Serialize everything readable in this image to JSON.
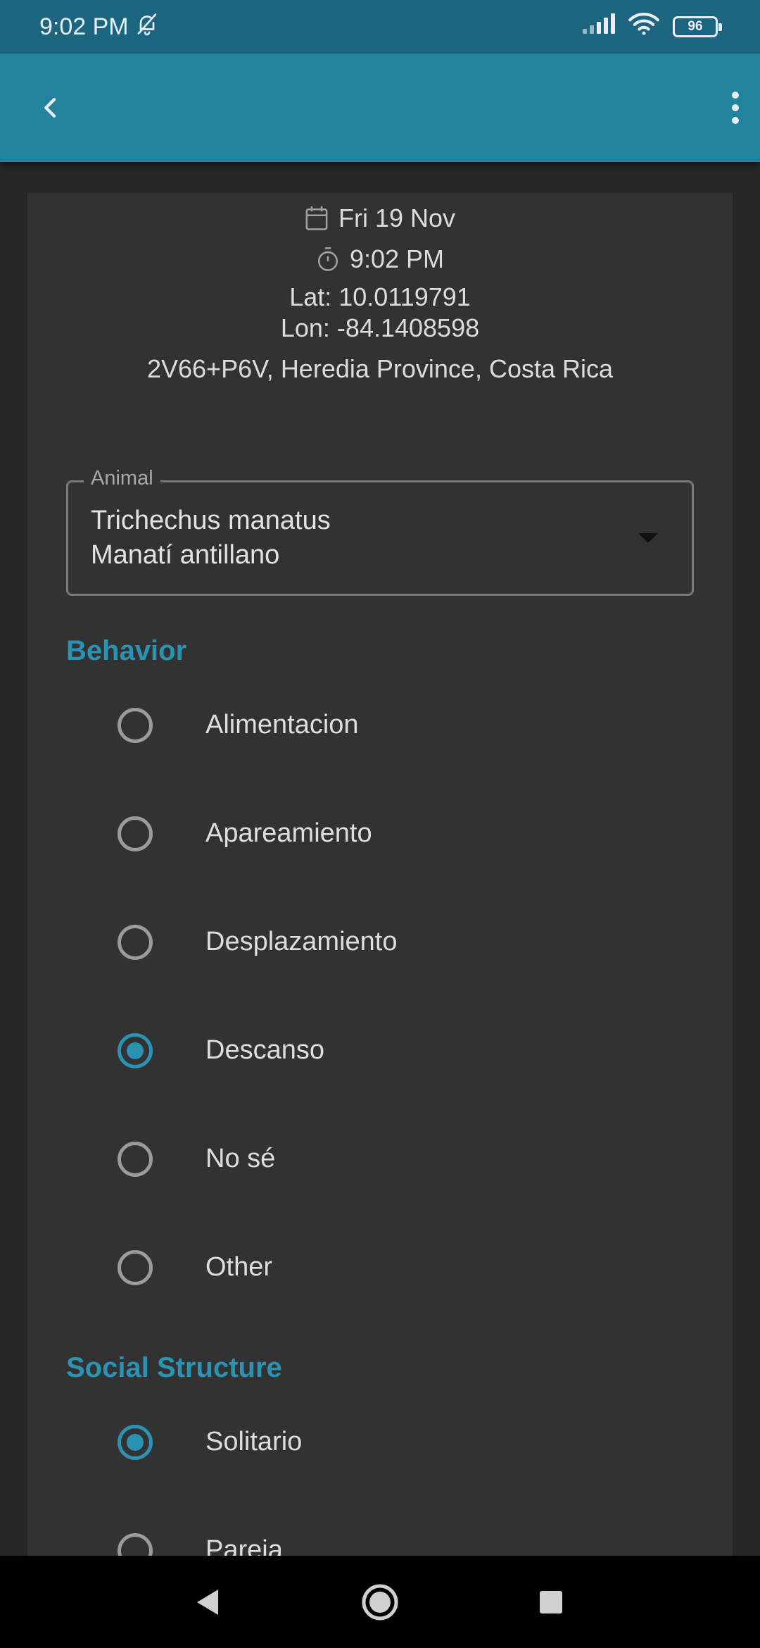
{
  "status_bar": {
    "time": "9:02 PM",
    "battery": "96"
  },
  "record": {
    "date": "Fri 19 Nov",
    "time": "9:02 PM",
    "lat": "Lat: 10.0119791",
    "lon": "Lon: -84.1408598",
    "address": "2V66+P6V, Heredia Province, Costa Rica"
  },
  "animal_field": {
    "label": "Animal",
    "scientific_name": "Trichechus manatus",
    "common_name": "Manatí antillano"
  },
  "behavior": {
    "title": "Behavior",
    "options": [
      {
        "label": "Alimentacion",
        "selected": false
      },
      {
        "label": "Apareamiento",
        "selected": false
      },
      {
        "label": "Desplazamiento",
        "selected": false
      },
      {
        "label": "Descanso",
        "selected": true
      },
      {
        "label": "No sé",
        "selected": false
      },
      {
        "label": "Other",
        "selected": false
      }
    ]
  },
  "social_structure": {
    "title": "Social Structure",
    "options": [
      {
        "label": "Solitario",
        "selected": true
      },
      {
        "label": "Pareja",
        "selected": false
      }
    ]
  },
  "colors": {
    "accent": "#2a93b3",
    "app_bar": "#23839f",
    "status_bar": "#1c6580",
    "card": "#323232"
  }
}
